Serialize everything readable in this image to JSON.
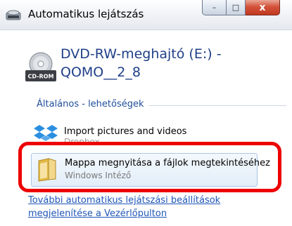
{
  "window": {
    "title": "Automatikus lejátszás",
    "controls": {
      "minimize": "–",
      "maximize": "□",
      "close": "x"
    }
  },
  "drive": {
    "title_line1": "DVD-RW-meghajtó (E:) -",
    "title_line2": "QOMO__2_8",
    "icon_badge": "CD-ROM"
  },
  "section": {
    "title": "Általános - lehetőségek"
  },
  "options": [
    {
      "label": "Import pictures and videos",
      "sublabel": "Dropbox",
      "icon": "dropbox-icon"
    },
    {
      "label": "Mappa megnyitása a fájlok megtekintéséhez",
      "sublabel": "Windows Intéző",
      "icon": "folder-icon"
    }
  ],
  "link": {
    "line1": "További automatikus lejátszási beállítások",
    "line2": "megjelenítése a Vezérlőpulton"
  },
  "colors": {
    "link": "#1e56b7",
    "section": "#1f4e9a",
    "drive_title": "#1f3f88",
    "highlight": "#ee0000",
    "close_button": "#c8442a"
  }
}
